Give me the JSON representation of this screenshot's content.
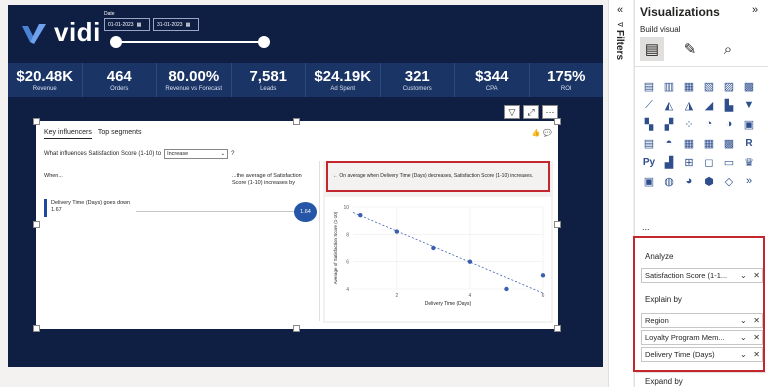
{
  "report": {
    "logo_text": "vidi",
    "date_label": "Date",
    "date_start": "01-01-2023",
    "date_end": "31-01-2023",
    "kpis": [
      {
        "value": "$20.48K",
        "label": "Revenue"
      },
      {
        "value": "464",
        "label": "Orders"
      },
      {
        "value": "80.00%",
        "label": "Revenue vs Forecast"
      },
      {
        "value": "7,581",
        "label": "Leads"
      },
      {
        "value": "$24.19K",
        "label": "Ad Spent"
      },
      {
        "value": "321",
        "label": "Customers"
      },
      {
        "value": "$344",
        "label": "CPA"
      },
      {
        "value": "175%",
        "label": "ROI"
      }
    ]
  },
  "visual": {
    "tab_key_influencers": "Key influencers",
    "tab_top_segments": "Top segments",
    "question_prefix": "What influences Satisfaction Score (1-10) to",
    "question_select": "Increase",
    "question_suffix": "?",
    "when_label": "When...",
    "avg_label": "...the average of Satisfaction Score (1-10) increases by",
    "influencer_text": "Delivery Time (Days) goes down 1.67",
    "influencer_value": "1.64",
    "insight_text": "← On average when Delivery Time (Days) decreases, Satisfaction Score (1-10) increases."
  },
  "chart_data": {
    "type": "scatter",
    "xlabel": "Delivery Time (Days)",
    "ylabel": "Average of Satisfaction Score (1-10)",
    "x_ticks": [
      "2",
      "4",
      "6"
    ],
    "y_ticks": [
      "4",
      "6",
      "8",
      "10"
    ],
    "xlim": [
      0.8,
      6
    ],
    "ylim": [
      4,
      10
    ],
    "points": [
      {
        "x": 1,
        "y": 9.4
      },
      {
        "x": 2,
        "y": 8.2
      },
      {
        "x": 3,
        "y": 7.0
      },
      {
        "x": 4,
        "y": 6.0
      },
      {
        "x": 5,
        "y": 4.0
      },
      {
        "x": 6,
        "y": 5.0
      }
    ],
    "trend": {
      "x0": 0.8,
      "y0": 9.6,
      "x1": 6,
      "y1": 3.7
    },
    "series_color": "#3b5fb0"
  },
  "sidebar": {
    "filters_label": "Filters",
    "title": "Visualizations",
    "build_visual": "Build visual",
    "more": "...",
    "analyze_label": "Analyze",
    "analyze_field": "Satisfaction Score (1-1...",
    "explain_label": "Explain by",
    "explain_fields": [
      "Region",
      "Loyalty Program Mem...",
      "Delivery Time (Days)"
    ],
    "expand_label": "Expand by"
  },
  "viz_icons": [
    "stacked-bar-icon",
    "stacked-column-icon",
    "clustered-bar-icon",
    "clustered-column-icon",
    "100-bar-icon",
    "100-column-icon",
    "line-chart-icon",
    "area-chart-icon",
    "stacked-area-icon",
    "ribbon-chart-icon",
    "waterfall-icon",
    "funnel-icon",
    "line-column-icon",
    "line-clustered-icon",
    "scatter-icon",
    "pie-chart-icon",
    "donut-icon",
    "card-123-icon",
    "matrix-icon",
    "gauge-icon",
    "kpi-icon",
    "table-icon",
    "matrix-grid-icon",
    "r-script-icon",
    "python-icon",
    "key-influencers-icon",
    "decomposition-tree-icon",
    "qa-icon",
    "narrative-icon",
    "trophy-icon",
    "paginated-icon",
    "map-icon",
    "filled-map-icon",
    "shape-map-icon",
    "diamond-icon",
    "chevrons-icon"
  ],
  "colors": {
    "canvas": "#0f1f44",
    "kpi_band": "#1a3466",
    "highlight": "#c4262e",
    "accent": "#2656a8"
  }
}
